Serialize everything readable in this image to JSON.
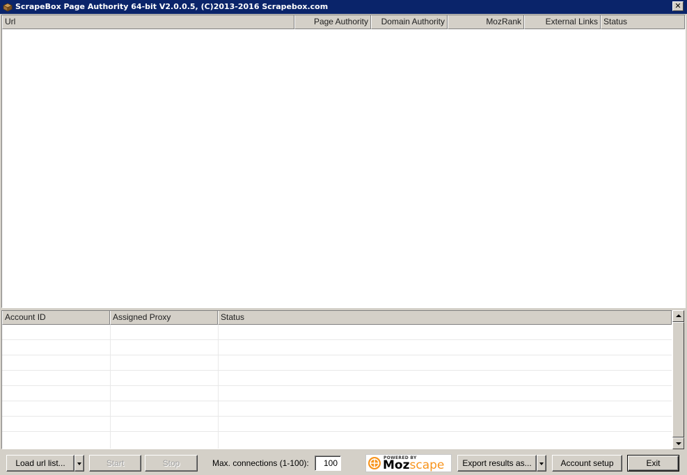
{
  "window": {
    "title": "ScrapeBox Page Authority 64-bit V2.0.0.5, (C)2013-2016 Scrapebox.com",
    "close_label": "✕"
  },
  "results_table": {
    "columns": [
      "Url",
      "Page Authority",
      "Domain Authority",
      "MozRank",
      "External Links",
      "Status"
    ],
    "rows": []
  },
  "accounts_table": {
    "columns": [
      "Account ID",
      "Assigned Proxy",
      "Status"
    ],
    "rows": []
  },
  "toolbar": {
    "load_label": "Load url list...",
    "start_label": "Start",
    "stop_label": "Stop",
    "max_conn_label": "Max. connections (1-100):",
    "max_conn_value": "100",
    "export_label": "Export results as...",
    "account_label": "Account setup",
    "exit_label": "Exit"
  },
  "moz": {
    "powered": "POWERED BY",
    "name_moz": "Moz",
    "name_scape": "scape",
    "brand_orange": "#f7941d"
  },
  "icons": {
    "app": "box-icon",
    "close": "close-icon",
    "dropdown": "chevron-down-icon",
    "scroll_up": "arrow-up-icon",
    "scroll_down": "arrow-down-icon"
  },
  "colors": {
    "titlebar": "#0a246a",
    "face": "#d4d0c8"
  }
}
